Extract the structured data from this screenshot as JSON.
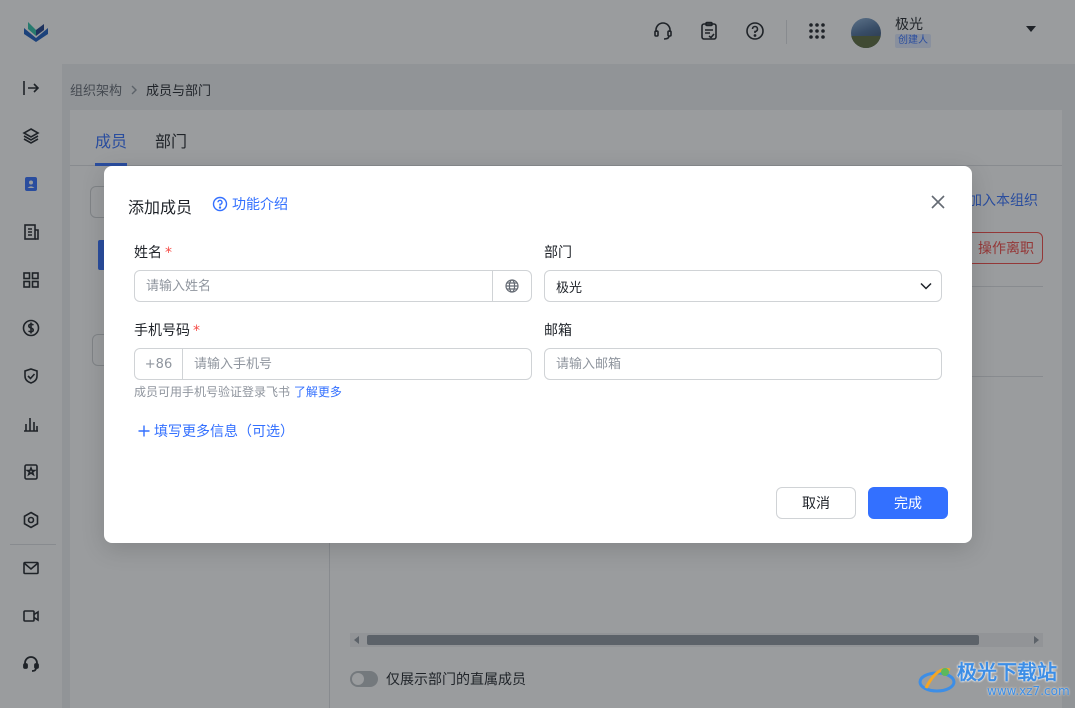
{
  "header": {
    "user_name": "极光",
    "user_role": "创建人"
  },
  "breadcrumb": {
    "parent": "组织架构",
    "current": "成员与部门"
  },
  "tabs": [
    {
      "label": "成员",
      "active": true
    },
    {
      "label": "部门",
      "active": false
    }
  ],
  "page": {
    "join_link": "加入本组织",
    "resign_button": "操作离职",
    "toggle_label": "仅展示部门的直属成员"
  },
  "modal": {
    "title": "添加成员",
    "help_link": "功能介绍",
    "name": {
      "label": "姓名",
      "placeholder": "请输入姓名"
    },
    "department": {
      "label": "部门",
      "value": "极光"
    },
    "phone": {
      "label": "手机号码",
      "prefix": "+86",
      "placeholder": "请输入手机号"
    },
    "email": {
      "label": "邮箱",
      "placeholder": "请输入邮箱"
    },
    "hint_text": "成员可用手机号验证登录飞书",
    "hint_link": "了解更多",
    "more_info": "填写更多信息（可选）",
    "cancel_label": "取消",
    "ok_label": "完成"
  },
  "watermark": {
    "text": "极光下载站",
    "url": "www.xz7.com"
  },
  "colors": {
    "accent": "#3370ff",
    "danger": "#f54a45",
    "required": "#f54a45"
  }
}
